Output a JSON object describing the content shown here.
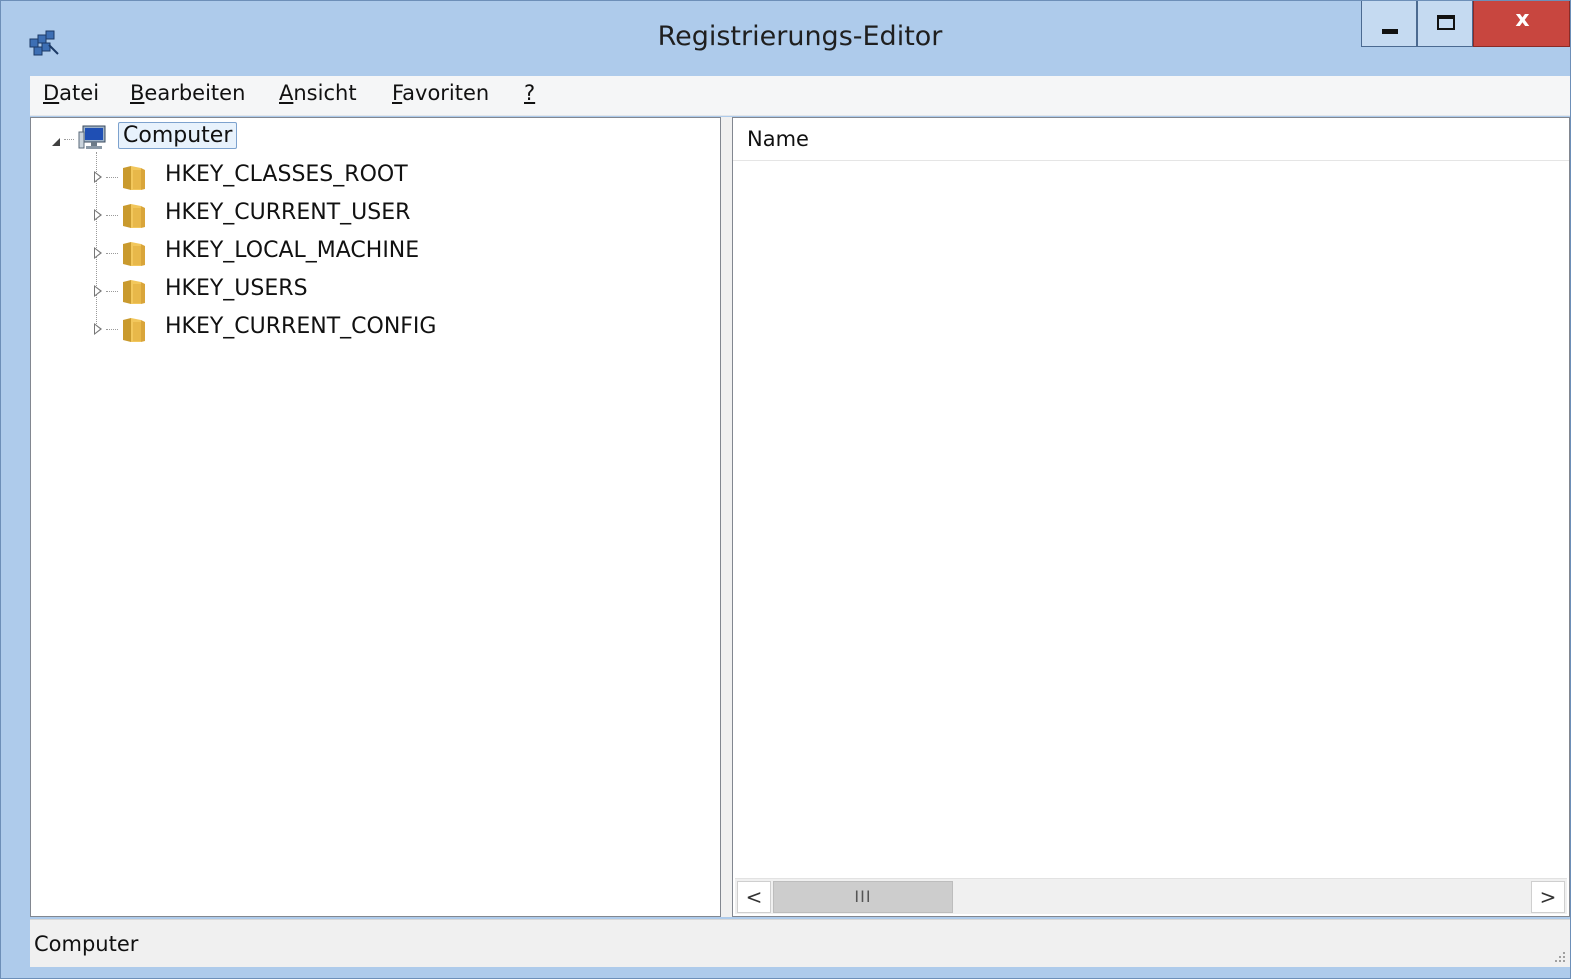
{
  "window": {
    "title": "Registrierungs-Editor",
    "close_glyph": "x"
  },
  "menu": {
    "items": [
      {
        "mnemonic": "D",
        "rest": "atei"
      },
      {
        "mnemonic": "B",
        "rest": "earbeiten"
      },
      {
        "mnemonic": "A",
        "rest": "nsicht"
      },
      {
        "mnemonic": "F",
        "rest": "avoriten"
      },
      {
        "mnemonic": "?",
        "rest": ""
      }
    ]
  },
  "tree": {
    "root": {
      "label": "Computer",
      "icon": "computer-icon",
      "expanded": true,
      "selected": true
    },
    "children": [
      {
        "label": "HKEY_CLASSES_ROOT",
        "icon": "folder-icon"
      },
      {
        "label": "HKEY_CURRENT_USER",
        "icon": "folder-icon"
      },
      {
        "label": "HKEY_LOCAL_MACHINE",
        "icon": "folder-icon"
      },
      {
        "label": "HKEY_USERS",
        "icon": "folder-icon"
      },
      {
        "label": "HKEY_CURRENT_CONFIG",
        "icon": "folder-icon"
      }
    ]
  },
  "list": {
    "columns": [
      "Name"
    ],
    "scroll_left": "<",
    "scroll_right": ">",
    "thumb_grip": "III"
  },
  "status": {
    "text": "Computer"
  },
  "colors": {
    "frame": "#aecbeb",
    "close_button": "#c8463f",
    "selection": "#e8f2fc",
    "folder": "#e8b84a"
  }
}
